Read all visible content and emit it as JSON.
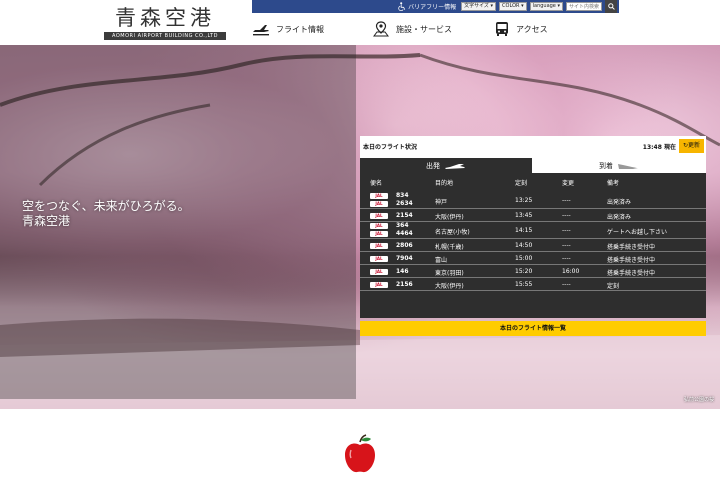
{
  "header": {
    "logo_main": "青森空港",
    "logo_sub": "AOMORI AIRPORT BUILDING CO.,LTD",
    "accessibility_label": "バリアフリー情報",
    "text_size_label": "文字サイズ",
    "color_label": "COLOR",
    "language_label": "language",
    "search_placeholder": "サイト内検索",
    "search_button_icon": "search-icon",
    "nav": {
      "flight": "フライト情報",
      "facility": "施設・サービス",
      "access": "アクセス"
    }
  },
  "hero": {
    "line1": "空をつなぐ、未来がひろがる。",
    "line2": "青森空港",
    "photo_credit": "弘前公園の桜"
  },
  "flights": {
    "title": "本日のフライト状況",
    "current_time": "13:48 現在",
    "refresh_label": "更新",
    "tabs": {
      "departure": "出発",
      "arrival": "到着"
    },
    "columns": [
      "便名",
      "目的地",
      "定刻",
      "変更",
      "備考"
    ],
    "rows": [
      {
        "airline": "JAL",
        "flight": [
          "834",
          "2634"
        ],
        "dest": "神戸",
        "sched": "13:25",
        "change": "----",
        "note": "出発済み"
      },
      {
        "airline": "JAL",
        "flight": [
          "2154"
        ],
        "dest": "大阪(伊丹)",
        "sched": "13:45",
        "change": "----",
        "note": "出発済み"
      },
      {
        "airline": "JAL",
        "flight": [
          "364",
          "4464"
        ],
        "dest": "名古屋(小牧)",
        "sched": "14:15",
        "change": "----",
        "note": "ゲートへお越し下さい"
      },
      {
        "airline": "JAL",
        "flight": [
          "2806"
        ],
        "dest": "札幌(千歳)",
        "sched": "14:50",
        "change": "----",
        "note": "搭乗手続き受付中"
      },
      {
        "airline": "JAL",
        "flight": [
          "7904"
        ],
        "dest": "富山",
        "sched": "15:00",
        "change": "----",
        "note": "搭乗手続き受付中"
      },
      {
        "airline": "JAL",
        "flight": [
          "146"
        ],
        "dest": "東京(羽田)",
        "sched": "15:20",
        "change": "16:00",
        "note": "搭乗手続き受付中"
      },
      {
        "airline": "JAL",
        "flight": [
          "2156"
        ],
        "dest": "大阪(伊丹)",
        "sched": "15:55",
        "change": "----",
        "note": "定刻"
      }
    ],
    "list_button": "本日のフライト情報一覧"
  },
  "footer": {
    "apple_icon": "apple-icon"
  },
  "colors": {
    "util_bar": "#2d4a8c",
    "table_bg": "#2e2e2e",
    "accent_yellow": "#ffcc00",
    "refresh": "#f7b500"
  }
}
